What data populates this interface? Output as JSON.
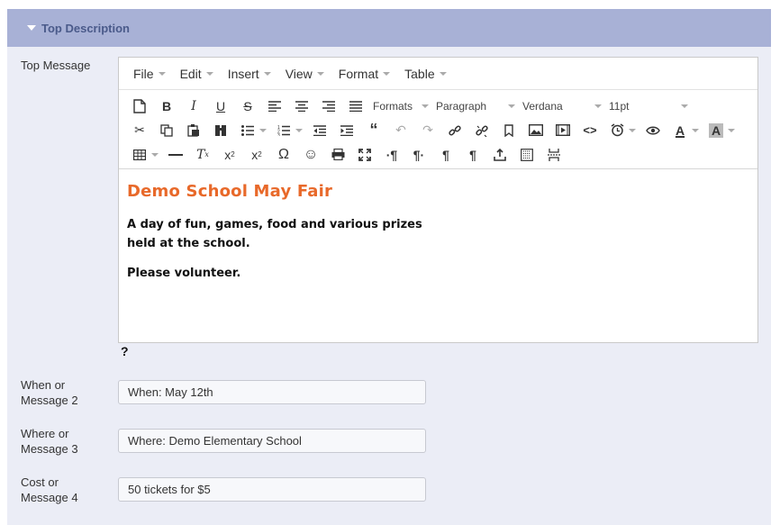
{
  "panel": {
    "title": "Top Description"
  },
  "labels": {
    "top_message": "Top Message",
    "when": "When or\nMessage 2",
    "where": "Where or\nMessage 3",
    "cost": "Cost or\nMessage 4"
  },
  "menubar": [
    "File",
    "Edit",
    "Insert",
    "View",
    "Format",
    "Table"
  ],
  "toolbar": {
    "formats": "Formats",
    "paragraph": "Paragraph",
    "font": "Verdana",
    "size": "11pt"
  },
  "editor_content": {
    "heading": "Demo School May Fair",
    "line1": "A day of fun, games, food and various prizes",
    "line2": "held at the school.",
    "line3": "Please volunteer."
  },
  "help_text": "?",
  "fields": {
    "when": "When:  May 12th",
    "where": "Where: Demo Elementary School",
    "cost": "50 tickets for $5"
  },
  "colors": {
    "header_bg": "#a8b1d6",
    "body_bg": "#ebedf6",
    "heading": "#e8692a"
  }
}
